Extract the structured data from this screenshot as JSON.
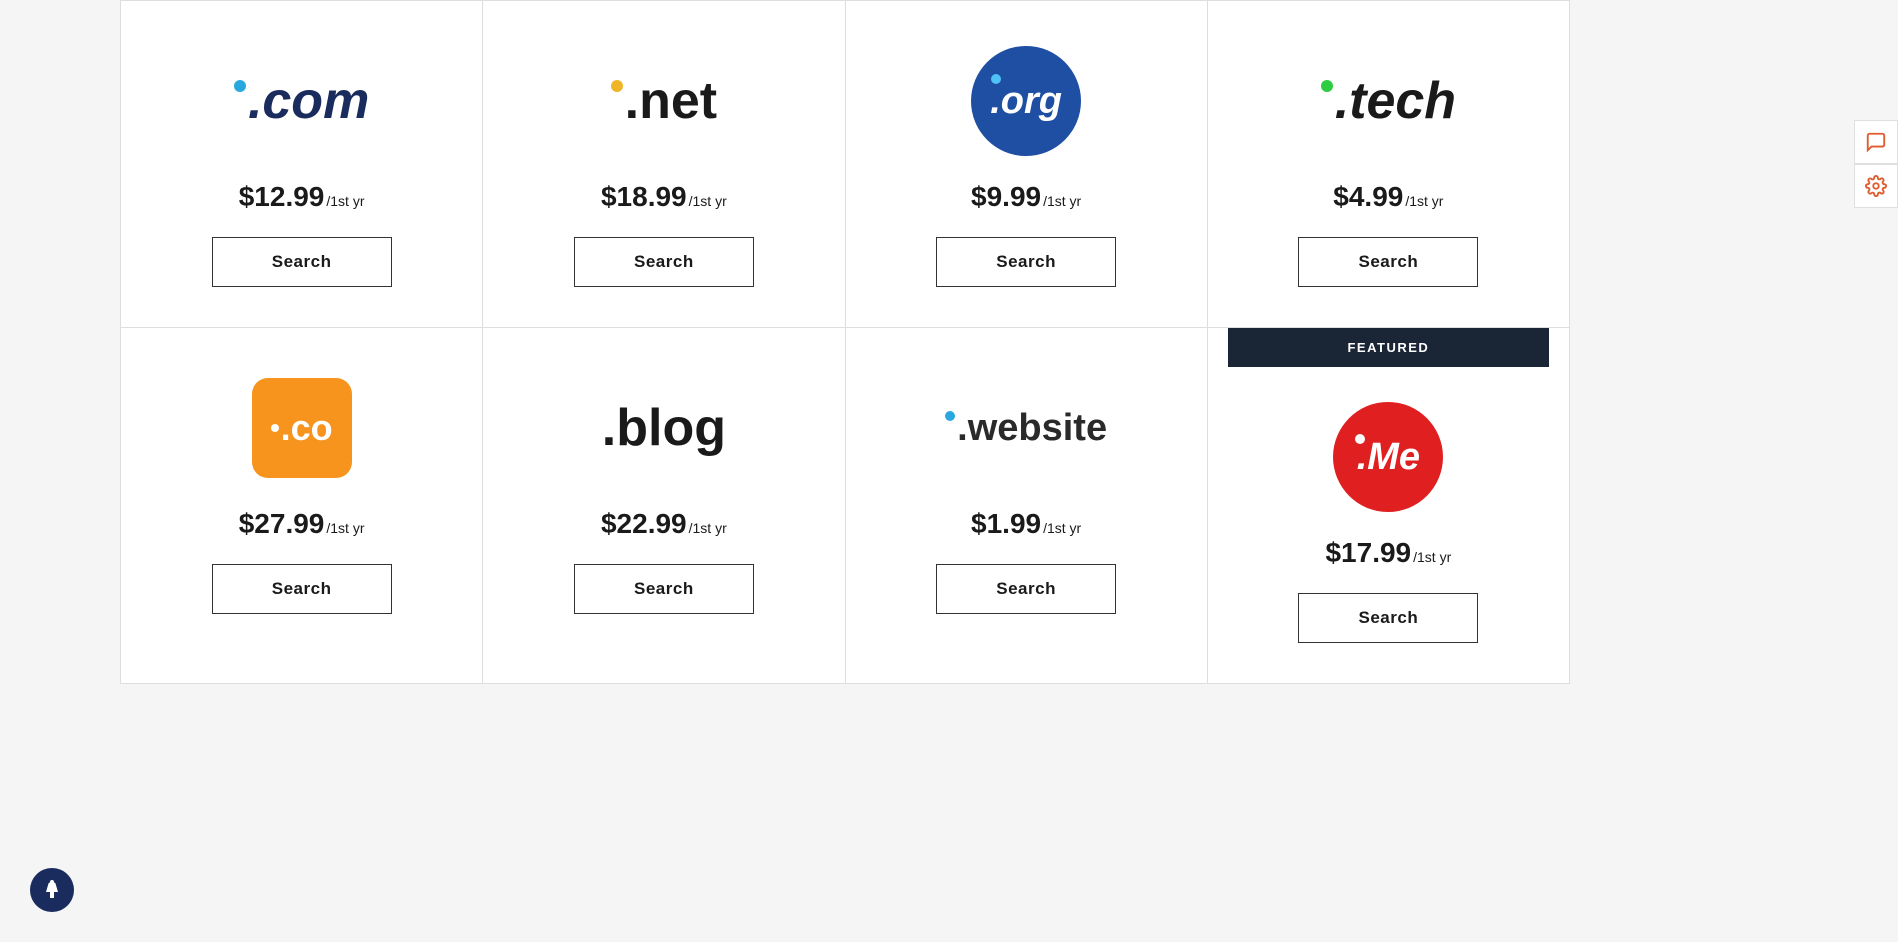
{
  "domains": [
    {
      "id": "com",
      "name": ".com",
      "price_main": "$12.99",
      "price_per": "/1st yr",
      "featured": false,
      "logo_type": "com"
    },
    {
      "id": "net",
      "name": ".net",
      "price_main": "$18.99",
      "price_per": "/1st yr",
      "featured": false,
      "logo_type": "net"
    },
    {
      "id": "org",
      "name": ".org",
      "price_main": "$9.99",
      "price_per": "/1st yr",
      "featured": false,
      "logo_type": "org"
    },
    {
      "id": "tech",
      "name": ".tech",
      "price_main": "$4.99",
      "price_per": "/1st yr",
      "featured": false,
      "logo_type": "tech"
    },
    {
      "id": "co",
      "name": ".co",
      "price_main": "$27.99",
      "price_per": "/1st yr",
      "featured": false,
      "logo_type": "co"
    },
    {
      "id": "blog",
      "name": ".blog",
      "price_main": "$22.99",
      "price_per": "/1st yr",
      "featured": false,
      "logo_type": "blog"
    },
    {
      "id": "website",
      "name": ".website",
      "price_main": "$1.99",
      "price_per": "/1st yr",
      "featured": false,
      "logo_type": "website"
    },
    {
      "id": "me",
      "name": ".Me",
      "price_main": "$17.99",
      "price_per": "/1st yr",
      "featured": true,
      "logo_type": "me"
    }
  ],
  "featured_label": "FEATURED",
  "search_label": "Search",
  "accessibility_label": "♿"
}
